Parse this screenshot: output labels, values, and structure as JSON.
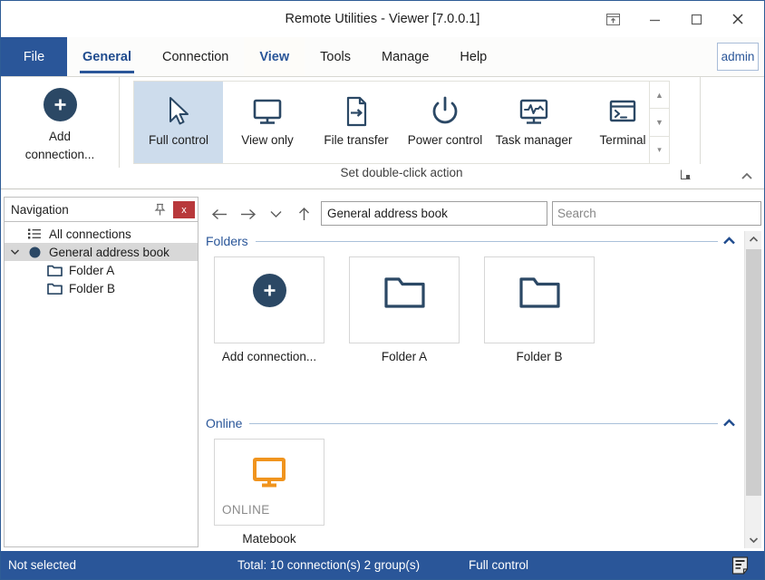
{
  "window": {
    "title": "Remote Utilities - Viewer [7.0.0.1]",
    "buttons": [
      {
        "name": "minimize-to-tray-button",
        "icon": "tray-icon"
      },
      {
        "name": "minimize-button",
        "icon": "minimize-icon"
      },
      {
        "name": "maximize-button",
        "icon": "maximize-icon"
      },
      {
        "name": "close-button",
        "icon": "close-icon"
      }
    ]
  },
  "menubar": {
    "file_label": "File",
    "user_label": "admin",
    "tabs": [
      {
        "label": "General",
        "state": "active"
      },
      {
        "label": "Connection",
        "state": "normal"
      },
      {
        "label": "View",
        "state": "hover"
      },
      {
        "label": "Tools",
        "state": "normal"
      },
      {
        "label": "Manage",
        "state": "normal"
      },
      {
        "label": "Help",
        "state": "normal"
      }
    ]
  },
  "ribbon": {
    "add_connection_label": "Add\nconnection...",
    "add_connection_line1": "Add",
    "add_connection_line2": "connection...",
    "group_caption": "Set double-click action",
    "items": [
      {
        "label": "Full control",
        "icon": "cursor-arrow-icon",
        "selected": true
      },
      {
        "label": "View only",
        "icon": "monitor-icon",
        "selected": false
      },
      {
        "label": "File transfer",
        "icon": "file-arrow-icon",
        "selected": false
      },
      {
        "label": "Power control",
        "icon": "power-icon",
        "selected": false
      },
      {
        "label": "Task manager",
        "icon": "monitor-pulse-icon",
        "selected": false
      },
      {
        "label": "Terminal",
        "icon": "terminal-icon",
        "selected": false
      }
    ]
  },
  "navigation": {
    "title": "Navigation",
    "pin_icon": "pin-icon",
    "close_label": "x",
    "tree": [
      {
        "label": "All connections",
        "icon": "list-icon",
        "indent": 1,
        "selected": false,
        "expander": ""
      },
      {
        "label": "General address book",
        "icon": "address-book-icon",
        "indent": 0,
        "selected": true,
        "expander": "v"
      },
      {
        "label": "Folder A",
        "icon": "folder-icon",
        "indent": 2,
        "selected": false,
        "expander": ""
      },
      {
        "label": "Folder B",
        "icon": "folder-icon",
        "indent": 2,
        "selected": false,
        "expander": ""
      }
    ]
  },
  "addressbar": {
    "back_icon": "arrow-left-icon",
    "forward_icon": "arrow-right-icon",
    "history_icon": "chevron-down-icon",
    "up_icon": "arrow-up-icon",
    "path_value": "General address book",
    "search_placeholder": "Search",
    "search_value": ""
  },
  "content": {
    "sections": [
      {
        "title": "Folders",
        "collapse_icon": "chevron-up-icon",
        "tiles": [
          {
            "caption": "Add connection...",
            "icon": "plus-circle-icon",
            "status": ""
          },
          {
            "caption": "Folder A",
            "icon": "folder-icon",
            "status": ""
          },
          {
            "caption": "Folder B",
            "icon": "folder-icon",
            "status": ""
          }
        ]
      },
      {
        "title": "Online",
        "collapse_icon": "chevron-up-icon",
        "tiles": [
          {
            "caption": "Matebook",
            "icon": "monitor-orange-icon",
            "status": "ONLINE"
          }
        ]
      }
    ]
  },
  "scrollbar": {
    "up_icon": "chevron-up-icon",
    "down_icon": "chevron-down-icon"
  },
  "statusbar": {
    "selection": "Not selected",
    "total": "Total: 10 connection(s) 2 group(s)",
    "mode": "Full control",
    "icon": "notes-icon"
  },
  "colors": {
    "accent": "#2a5699",
    "ribbon_selected": "#cddcec",
    "icon_dark": "#2b4865",
    "online_orange": "#f0941e",
    "close_red": "#b8383b"
  }
}
